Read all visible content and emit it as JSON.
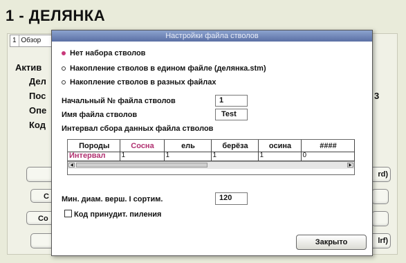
{
  "page_title": "1 - ДЕЛЯНКА",
  "background": {
    "tab": {
      "number": "1",
      "label": "Обзор"
    },
    "labels": [
      "Актив",
      "Дел",
      "Пос",
      "Опе",
      "Код"
    ],
    "right_digit": "3",
    "buttons": [
      "С",
      "Со",
      "rd)",
      "lrf)"
    ]
  },
  "dialog": {
    "title": "Настройки файла стволов",
    "radios": [
      {
        "label": "Нет набора стволов",
        "selected": true
      },
      {
        "label": "Накопление стволов в едином файле (делянка.stm)",
        "selected": false
      },
      {
        "label": "Накопление стволов в разных файлах",
        "selected": false
      }
    ],
    "start_file_label": "Начальный № файла стволов",
    "start_file_value": "1",
    "file_name_label": "Имя файла стволов",
    "file_name_value": "Test",
    "interval_label": "Интервал сбора данных файла стволов",
    "grid": {
      "headers": [
        "Породы",
        "Сосна",
        "ель",
        "берёза",
        "осина",
        "####"
      ],
      "row_label": "Интервал",
      "row_values": [
        "1",
        "1",
        "1",
        "1",
        "0"
      ]
    },
    "min_diam_label": "Мин. диам. верш. I сортим.",
    "min_diam_value": "120",
    "forced_cut_label": "Код принудит. пиления",
    "forced_cut_checked": false,
    "close_label": "Закрыто"
  }
}
